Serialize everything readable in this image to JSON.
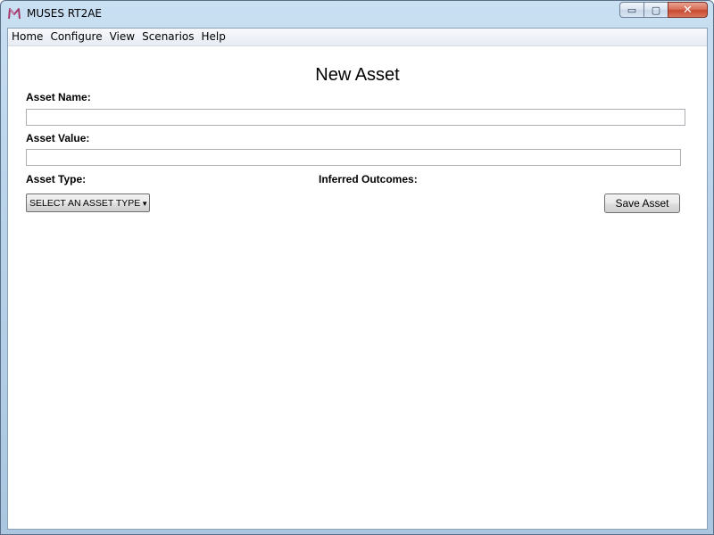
{
  "window": {
    "title": "MUSES RT2AE",
    "icon": "muses-logo-icon",
    "caption_buttons": {
      "minimize": "▭",
      "maximize": "▢",
      "close": "✕"
    }
  },
  "menu": {
    "items": [
      {
        "label": "Home"
      },
      {
        "label": "Configure"
      },
      {
        "label": "View"
      },
      {
        "label": "Scenarios"
      },
      {
        "label": "Help"
      }
    ]
  },
  "form": {
    "title": "New Asset",
    "asset_name_label": "Asset Name:",
    "asset_name_value": "",
    "asset_value_label": "Asset Value:",
    "asset_value_value": "",
    "asset_type_label": "Asset Type:",
    "asset_type_selected": "SELECT AN ASSET TYPE",
    "inferred_outcomes_label": "Inferred Outcomes:",
    "save_button_label": "Save Asset"
  },
  "colors": {
    "window_frame": "#b9d3ea",
    "close_button": "#c74a31",
    "logo_accent": "#a23a6b"
  }
}
